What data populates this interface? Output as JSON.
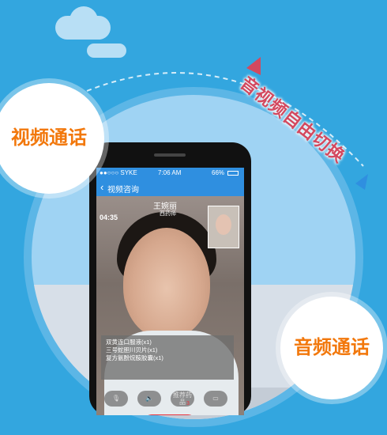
{
  "colors": {
    "background": "#33a6df",
    "badge_text": "#f2780c",
    "switch_text": "#d3495f",
    "accent": "#2f8fe0",
    "hangup": "#e9343e"
  },
  "badges": {
    "video": "视频通话",
    "audio": "音频通话"
  },
  "switch_label": "音视频自由切换",
  "phone": {
    "statusbar": {
      "carrier": "●●○○○ SYKE",
      "time": "7:06 AM",
      "battery": "66%"
    },
    "nav": {
      "back_label": "视频咨询",
      "back_icon": "chevron-left-icon"
    },
    "call": {
      "timer": "04:35",
      "name": "王婉丽",
      "role": "西药师"
    },
    "prescription": [
      "双黄连口服液(x1)",
      "三号蛇胆川贝片(x1)",
      "复方氨酚烷胺胶囊(x1)"
    ],
    "controls": [
      {
        "icon": "mute-icon"
      },
      {
        "icon": "speaker-icon"
      },
      {
        "label": "推荐药品",
        "badge": "3"
      },
      {
        "icon": "switch-camera-icon"
      }
    ],
    "hangup_icon": "hangup-icon"
  }
}
